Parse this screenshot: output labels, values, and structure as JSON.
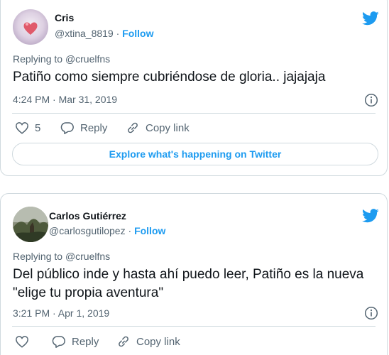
{
  "tweets": [
    {
      "name": "Cris",
      "handle": "@xtina_8819",
      "separator": "·",
      "follow_label": "Follow",
      "replying_prefix": "Replying to ",
      "replying_to": "@cruelfns",
      "text": "Patiño como siempre cubriéndose de gloria.. jajajaja",
      "timestamp": "4:24 PM · Mar 31, 2019",
      "likes": "5",
      "reply_label": "Reply",
      "copy_label": "Copy link",
      "explore_label": "Explore what's happening on Twitter"
    },
    {
      "name": "Carlos Gutiérrez",
      "handle": "@carlosgutilopez",
      "separator": "·",
      "follow_label": "Follow",
      "replying_prefix": "Replying to ",
      "replying_to": "@cruelfns",
      "text": "Del público inde y hasta ahí puedo leer, Patiño es la nueva \"elige tu propia aventura\"",
      "timestamp": "3:21 PM · Apr 1, 2019",
      "reply_label": "Reply",
      "copy_label": "Copy link"
    }
  ],
  "icons": {
    "brand": "twitter-bird-icon",
    "info": "info-icon",
    "like": "heart-icon",
    "reply": "reply-bubble-icon",
    "copy": "link-icon"
  },
  "colors": {
    "accent": "#1d9bf0",
    "text": "#0f1419",
    "muted": "#536471",
    "border": "#cfd9de"
  }
}
